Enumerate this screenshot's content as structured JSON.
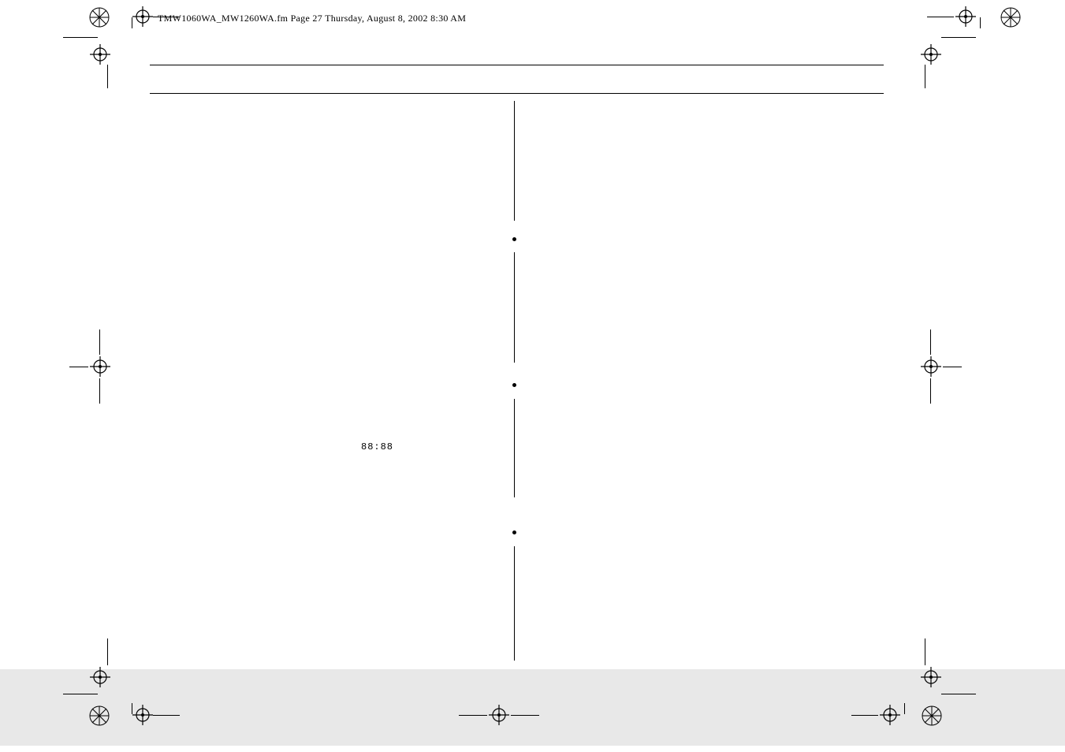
{
  "header": {
    "line": "TMW1060WA_MW1260WA.fm  Page 27  Thursday, August 8, 2002  8:30 AM"
  },
  "mid_left_text": "88:88",
  "colors": {
    "band": "#e8e8e8"
  }
}
